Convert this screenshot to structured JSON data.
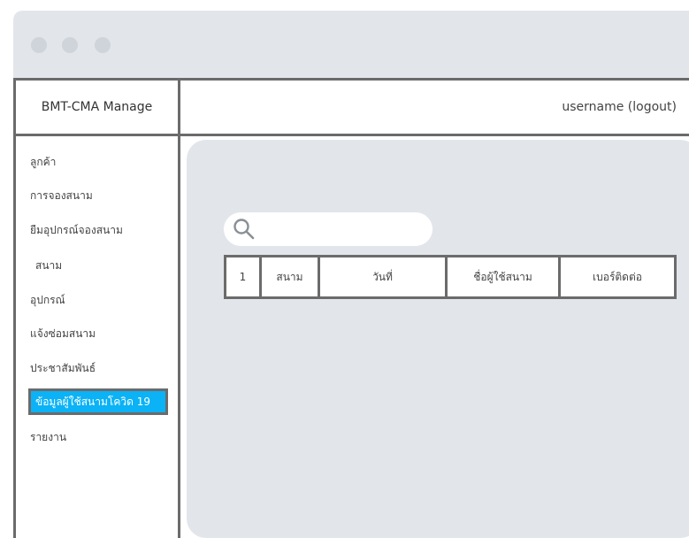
{
  "header": {
    "brand": "BMT-CMA Manage",
    "user": "username (logout)"
  },
  "sidebar": {
    "items": [
      {
        "label": "ลูกค้า"
      },
      {
        "label": "การจองสนาม"
      },
      {
        "label": "ยืมอุปกรณ์จองสนาม"
      },
      {
        "label": "สนาม"
      },
      {
        "label": "อุปกรณ์"
      },
      {
        "label": "แจ้งซ่อมสนาม"
      },
      {
        "label": "ประชาสัมพันธ์"
      },
      {
        "label": "ข้อมูลผู้ใช้สนามโควิด 19"
      },
      {
        "label": "รายงาน"
      }
    ],
    "active_index": 7
  },
  "search": {
    "placeholder": "",
    "icon": "search-icon"
  },
  "table": {
    "cells": [
      "1",
      "สนาม",
      "วันที่",
      "ชื่อผู้ใช้สนาม",
      "เบอร์ติดต่อ"
    ]
  },
  "colors": {
    "titlebar": "#e2e6eb",
    "content_bg": "#e2e6eb",
    "active_item": "#0bb2f5",
    "border": "#6b6b6b"
  }
}
